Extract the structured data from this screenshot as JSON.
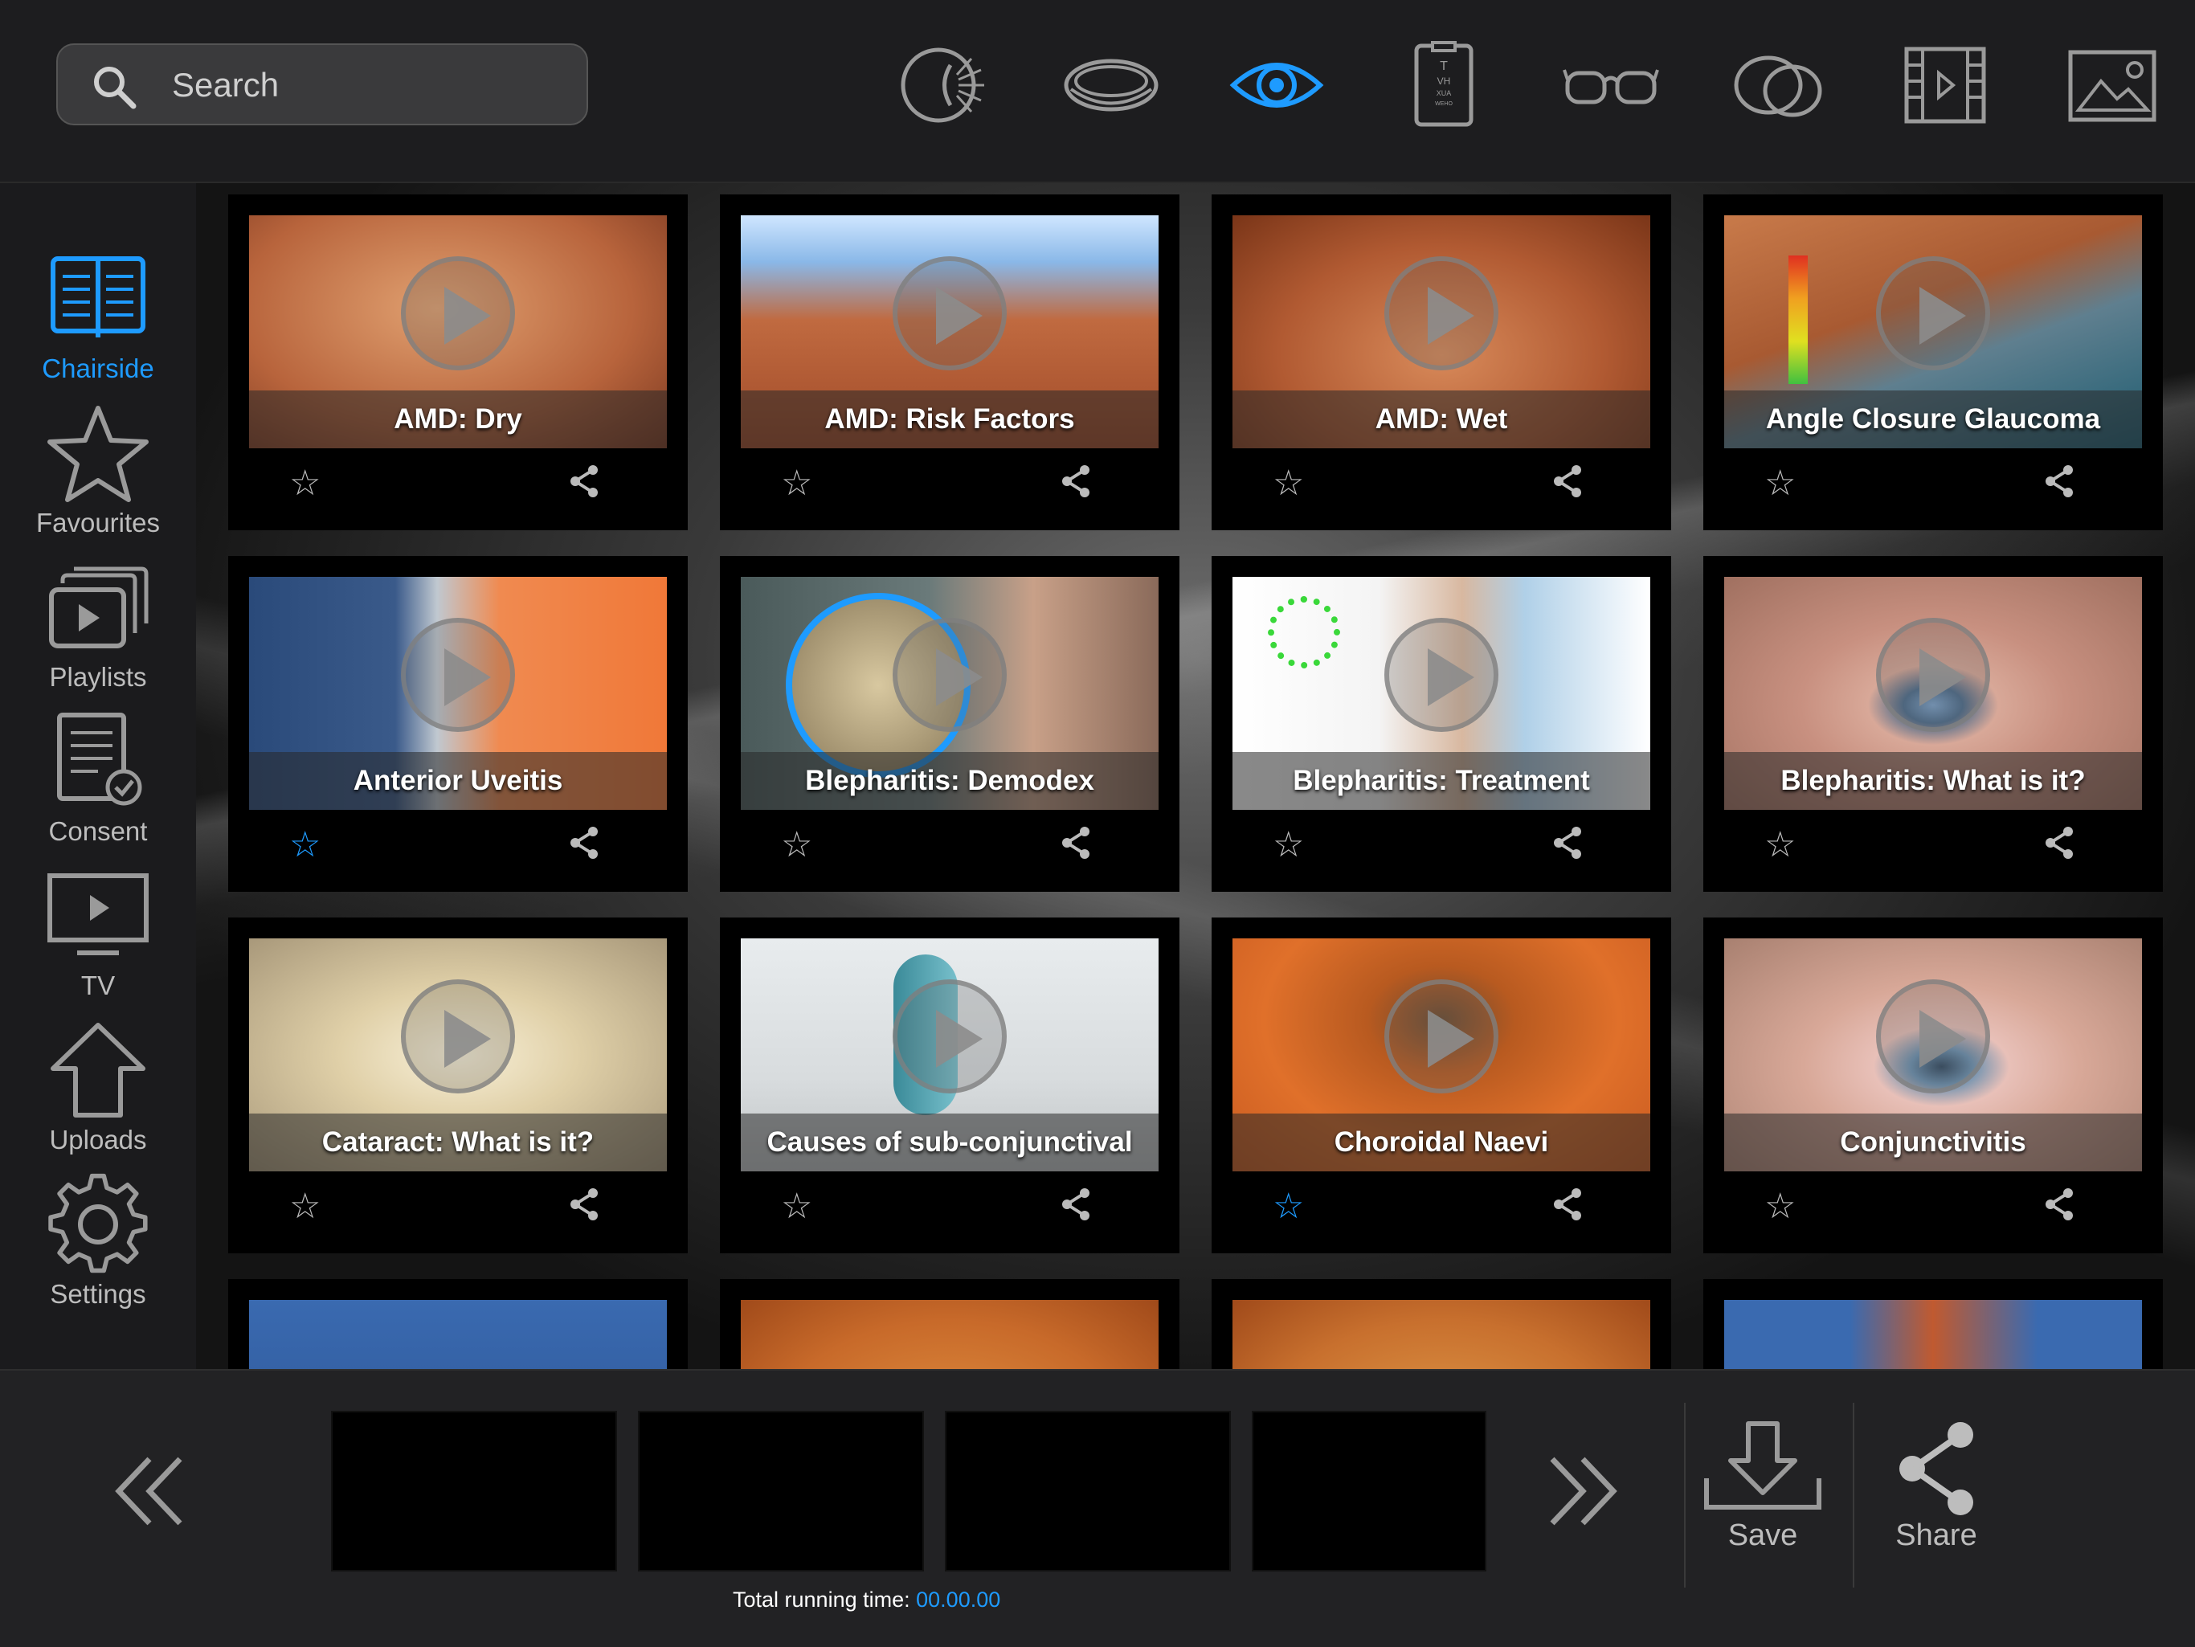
{
  "search": {
    "placeholder": "Search"
  },
  "top_icons": [
    "anatomy-icon",
    "contact-lens-icon",
    "eye-icon",
    "eye-chart-icon",
    "glasses-icon",
    "lens-overlap-icon",
    "film-icon",
    "image-icon"
  ],
  "sidebar": {
    "items": [
      {
        "label": "Chairside",
        "active": true
      },
      {
        "label": "Favourites"
      },
      {
        "label": "Playlists"
      },
      {
        "label": "Consent"
      },
      {
        "label": "TV"
      },
      {
        "label": "Uploads"
      },
      {
        "label": "Settings"
      }
    ]
  },
  "videos": [
    {
      "title": "AMD: Dry",
      "favourite": false
    },
    {
      "title": "AMD: Risk Factors",
      "favourite": false
    },
    {
      "title": "AMD: Wet",
      "favourite": false
    },
    {
      "title": "Angle Closure Glaucoma",
      "favourite": false
    },
    {
      "title": "Anterior Uveitis",
      "favourite": true
    },
    {
      "title": "Blepharitis: Demodex",
      "favourite": false
    },
    {
      "title": "Blepharitis: Treatment",
      "favourite": false
    },
    {
      "title": "Blepharitis: What is it?",
      "favourite": false
    },
    {
      "title": "Cataract: What is it?",
      "favourite": false
    },
    {
      "title": "Causes of sub-conjunctival",
      "favourite": false
    },
    {
      "title": "Choroidal Naevi",
      "favourite": true
    },
    {
      "title": "Conjunctivitis",
      "favourite": false
    }
  ],
  "icons": {
    "star": "☆",
    "star_filled": "☆"
  },
  "bottom": {
    "runtime_label": "Total running time:",
    "runtime_value": "00.00.00",
    "save_label": "Save",
    "share_label": "Share"
  },
  "colors": {
    "accent": "#1e9bff"
  }
}
